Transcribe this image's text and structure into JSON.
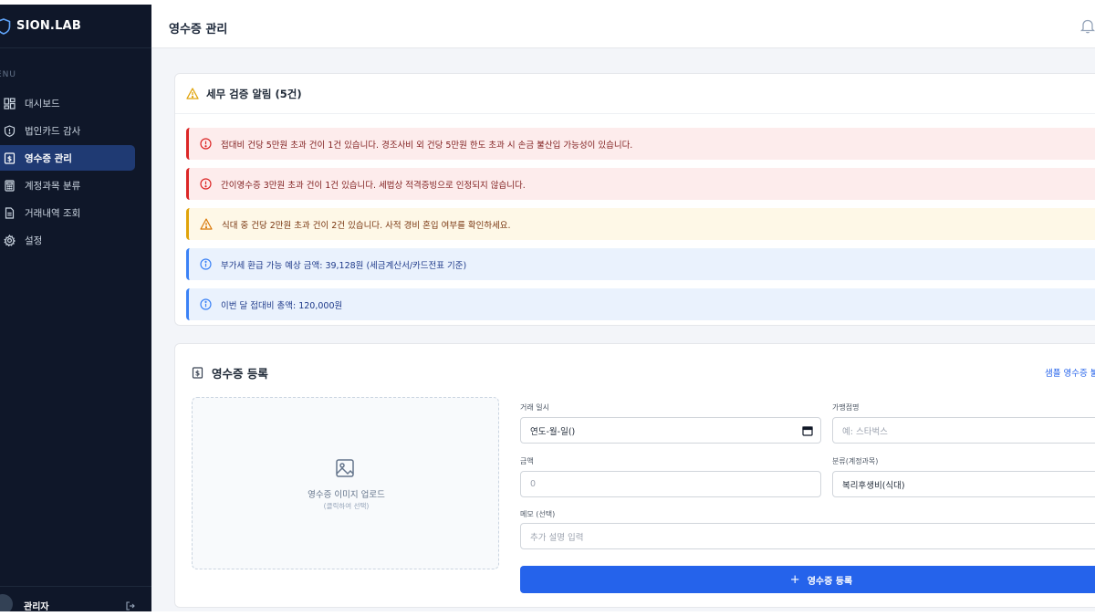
{
  "sidebar": {
    "brand": "SION.LAB",
    "menu_label": "ENU",
    "items": [
      {
        "label": "대시보드",
        "icon": "dashboard-icon"
      },
      {
        "label": "법인카드 감사",
        "icon": "shield-icon"
      },
      {
        "label": "영수증 관리",
        "icon": "receipt-icon",
        "active": true
      },
      {
        "label": "계정과목 분류",
        "icon": "calculator-icon"
      },
      {
        "label": "거래내역 조회",
        "icon": "document-icon"
      },
      {
        "label": "설정",
        "icon": "gear-icon"
      }
    ],
    "user_name": "관리자"
  },
  "header": {
    "title": "영수증 관리"
  },
  "alerts": {
    "title": "세무 검증 알림 (5건)",
    "items": [
      {
        "type": "danger",
        "text": "접대비 건당 5만원 초과 건이 1건 있습니다. 경조사비 외 건당 5만원 한도 초과 시 손금 불산입 가능성이 있습니다."
      },
      {
        "type": "danger",
        "text": "간이영수증 3만원 초과 건이 1건 있습니다. 세법상 적격증빙으로 인정되지 않습니다."
      },
      {
        "type": "warning",
        "text": "식대 중 건당 2만원 초과 건이 2건 있습니다. 사적 경비 혼입 여부를 확인하세요."
      },
      {
        "type": "info",
        "text": "부가세 환급 가능 예상 금액: 39,128원 (세금계산서/카드전표 기준)"
      },
      {
        "type": "info",
        "text": "이번 달 접대비 총액: 120,000원"
      }
    ]
  },
  "form": {
    "title": "영수증 등록",
    "sample_link": "샘플 영수증 불",
    "upload_text": "영수증 이미지 업로드",
    "upload_sub": "(클릭하여 선택)",
    "date_label": "거래 일시",
    "date_value": "연도-월-일()",
    "merchant_label": "가맹점명",
    "merchant_placeholder": "예: 스타벅스",
    "amount_label": "금액",
    "amount_placeholder": "0",
    "category_label": "분류(계정과목)",
    "category_value": "복리후생비(식대)",
    "memo_label": "메모 (선택)",
    "memo_placeholder": "추가 설명 입력",
    "submit_label": "영수증 등록",
    "submit_icon": "+"
  },
  "colors": {
    "sidebar_bg": "#0f1729",
    "active_bg": "#1f3a73",
    "accent": "#2563eb",
    "danger": "#dc2626",
    "warning": "#e0a309",
    "info": "#3b82f6"
  }
}
